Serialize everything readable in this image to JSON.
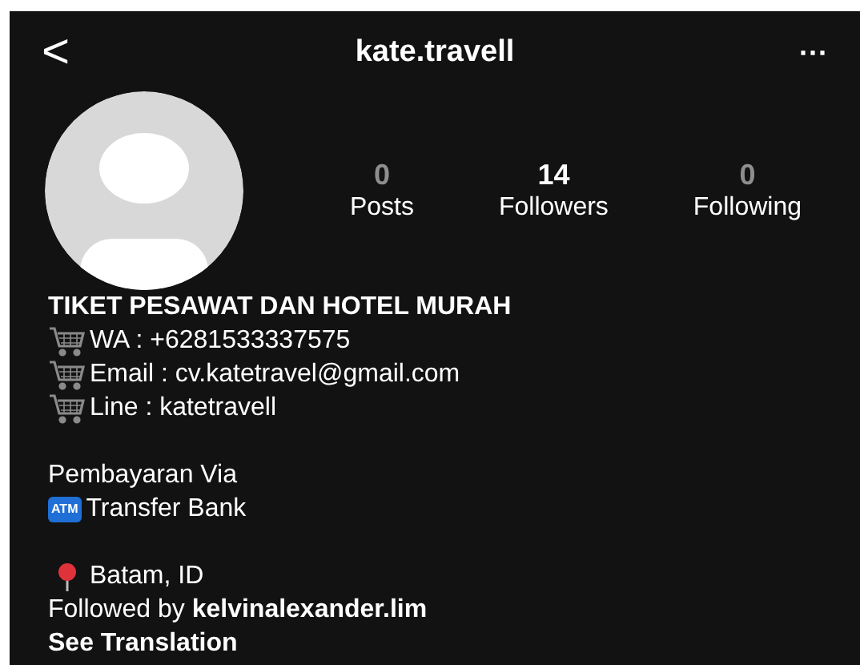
{
  "header": {
    "back": "<",
    "title": "kate.travell",
    "more": "···"
  },
  "stats": [
    {
      "value": "0",
      "label": "Posts",
      "disabled": true
    },
    {
      "value": "14",
      "label": "Followers",
      "disabled": false
    },
    {
      "value": "0",
      "label": "Following",
      "disabled": true
    }
  ],
  "bio": {
    "headline": "TIKET PESAWAT DAN HOTEL MURAH",
    "contacts": [
      "WA : +6281533337575",
      "Email : cv.katetravel@gmail.com",
      "Line : katetravell"
    ],
    "payment_title": "Pembayaran Via",
    "payment_method": {
      "badge": "ATM",
      "label": "Transfer Bank"
    },
    "location": "Batam, ID"
  },
  "followed_by": {
    "prefix": "Followed by",
    "name": "kelvinalexander.lim"
  },
  "translation_link": "See Translation"
}
